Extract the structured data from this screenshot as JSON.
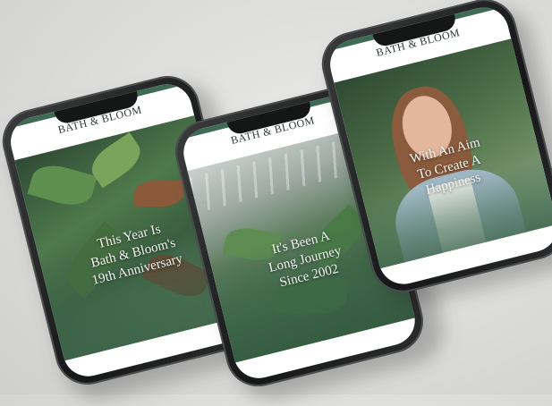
{
  "phones": [
    {
      "brand": "BATH & BLOOM",
      "headline": "This Year Is\nBath & Bloom's\n19th Anniversary",
      "accent": "#3f6b55"
    },
    {
      "brand": "BATH & BLOOM",
      "headline": "It's Been A\nLong Journey\nSince 2002",
      "accent": "#3f6b55"
    },
    {
      "brand": "BATH & BLOOM",
      "headline": "With An Aim\nTo Create A\nHappiness",
      "accent": "#3f6b55"
    }
  ]
}
